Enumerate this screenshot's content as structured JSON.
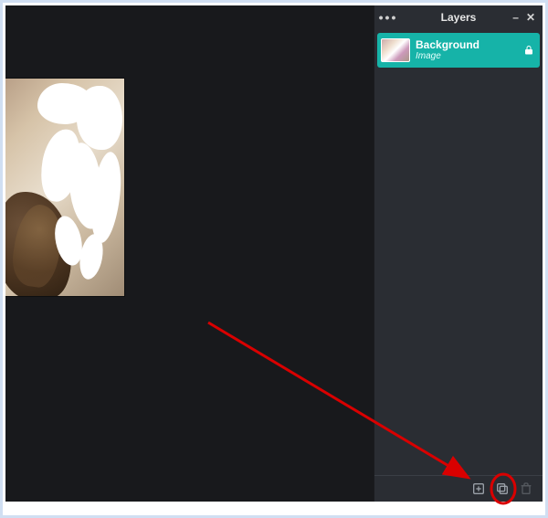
{
  "panel": {
    "title": "Layers",
    "more_label": "•••",
    "minimize_label": "–",
    "close_label": "✕"
  },
  "layers": [
    {
      "name": "Background",
      "type": "Image",
      "locked": true,
      "selected": true
    }
  ],
  "footer": {
    "add_layer_label": "Add layer",
    "duplicate_layer_label": "Duplicate layer",
    "delete_layer_label": "Delete layer"
  },
  "colors": {
    "accent": "#16b3a8",
    "panel_bg": "#2a2d33",
    "canvas_bg": "#18191c",
    "annotation": "#d90000"
  }
}
